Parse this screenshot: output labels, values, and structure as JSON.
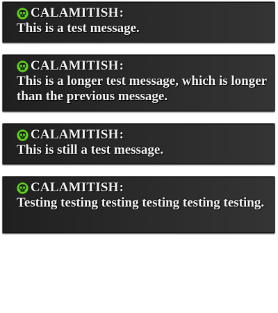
{
  "messages": [
    {
      "author": "CALAMITISH",
      "separator": ":",
      "avatar_icon": "alien-skull-icon",
      "text": "This is a test message."
    },
    {
      "author": "CALAMITISH",
      "separator": ":",
      "avatar_icon": "alien-skull-icon",
      "text": "This is a longer test message, which is longer than the previous message."
    },
    {
      "author": "CALAMITISH",
      "separator": ":",
      "avatar_icon": "alien-skull-icon",
      "text": "This is still a test message."
    },
    {
      "author": "CALAMITISH",
      "separator": ":",
      "avatar_icon": "alien-skull-icon",
      "text": "Testing testing testing testing testing testing."
    }
  ],
  "colors": {
    "avatar_green": "#5fd61c",
    "panel_dark": "#202020",
    "text": "#f4f4f4"
  }
}
